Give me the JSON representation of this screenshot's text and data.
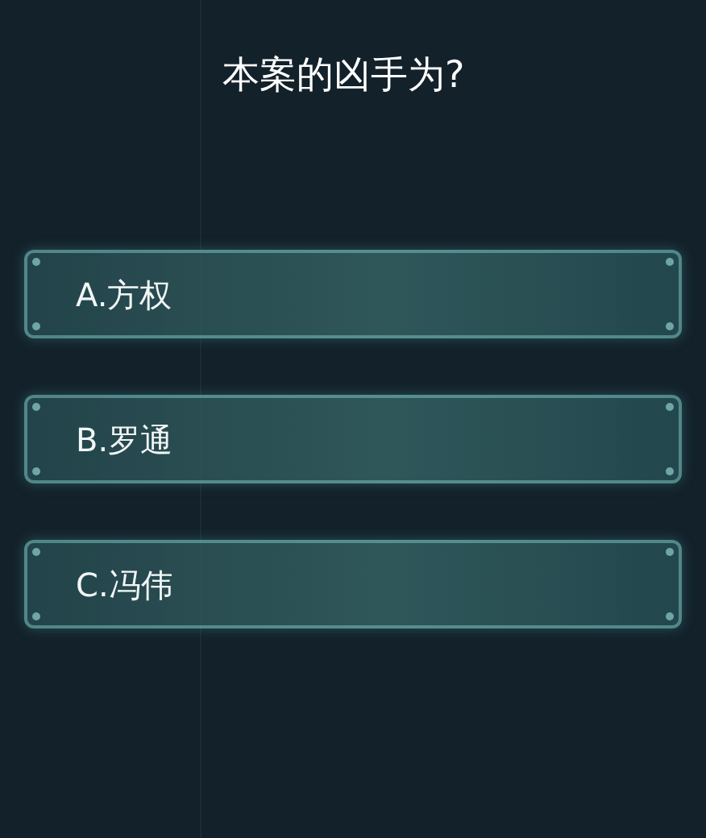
{
  "question": {
    "title": "本案的凶手为?",
    "options": [
      {
        "label": "A.方权",
        "selected": false
      },
      {
        "label": "B.罗通",
        "selected": false
      },
      {
        "label": "C.冯伟",
        "selected": false
      }
    ]
  }
}
